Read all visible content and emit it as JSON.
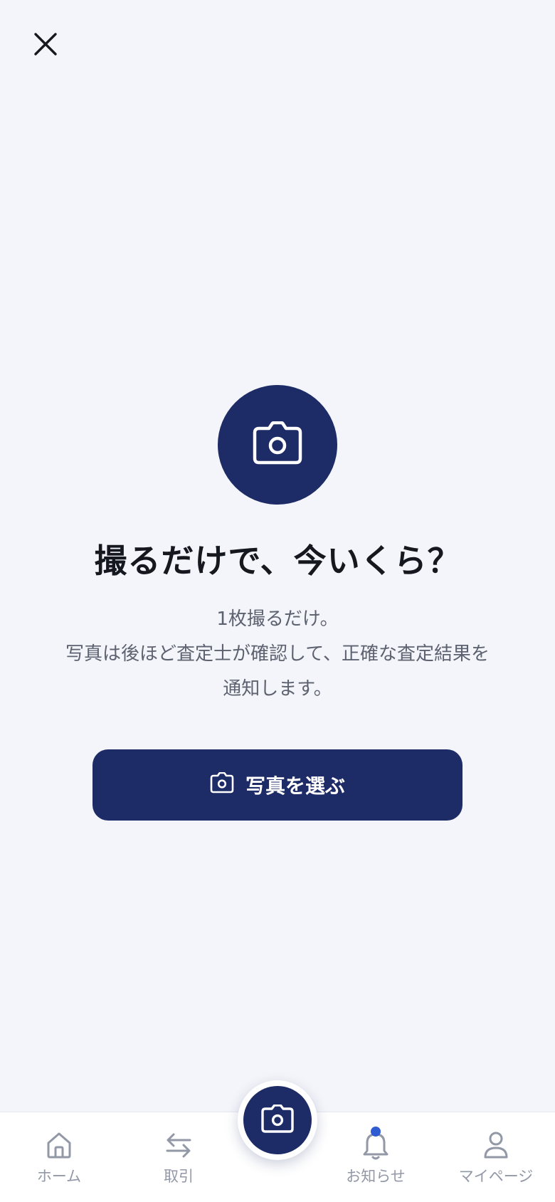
{
  "header": {
    "close_icon": "close-icon"
  },
  "hero": {
    "icon": "camera-icon",
    "title": "撮るだけで、今いくら？",
    "description": [
      "1枚撮るだけ。",
      "写真は後ほど査定士が確認して、正確な査定結果を",
      "通知します。"
    ]
  },
  "action": {
    "icon": "camera-icon",
    "label": "写真を選ぶ"
  },
  "tabbar": {
    "items": [
      {
        "label": "ホーム",
        "icon": "home-icon"
      },
      {
        "label": "取引",
        "icon": "transfer-arrows-icon"
      },
      {
        "label": "",
        "icon": "camera-icon"
      },
      {
        "label": "お知らせ",
        "icon": "bell-icon",
        "has_badge": true
      },
      {
        "label": "マイページ",
        "icon": "user-icon"
      }
    ]
  },
  "colors": {
    "background": "#f4f5fa",
    "primary": "#1d2b66",
    "text_dark": "#16181f",
    "text_muted": "#5d6270",
    "tab_inactive": "#9298a6",
    "badge": "#2f5bd3"
  }
}
